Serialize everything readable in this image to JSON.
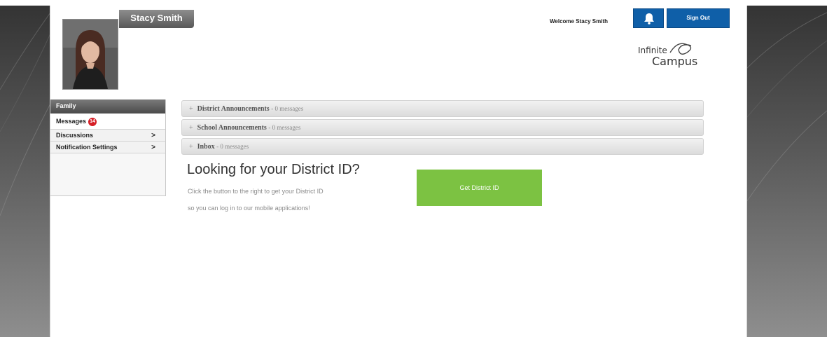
{
  "profile": {
    "name": "Stacy Smith"
  },
  "header": {
    "welcome": "Welcome Stacy Smith",
    "sign_out": "Sign Out",
    "bell_icon": "bell-icon",
    "logo_line1": "Infinite",
    "logo_line2": "Campus"
  },
  "nav": {
    "header": "Family",
    "items": [
      {
        "label": "Messages",
        "badge": "14"
      },
      {
        "label": "Discussions",
        "chevron": ">"
      },
      {
        "label": "Notification Settings",
        "chevron": ">"
      }
    ]
  },
  "announcements": [
    {
      "toggle": "+",
      "title": "District Announcements",
      "count": "- 0 messages"
    },
    {
      "toggle": "+",
      "title": "School Announcements",
      "count": "- 0 messages"
    },
    {
      "toggle": "+",
      "title": "Inbox",
      "count": "- 0 messages"
    }
  ],
  "district_id": {
    "title": "Looking for your District ID?",
    "line1": "Click the button to the right to get your District ID",
    "line2": "so you can log in to our mobile applications!",
    "button": "Get District ID"
  },
  "colors": {
    "primary_blue": "#0f5fa8",
    "green_button": "#7cc242",
    "badge_red": "#d61f26"
  }
}
